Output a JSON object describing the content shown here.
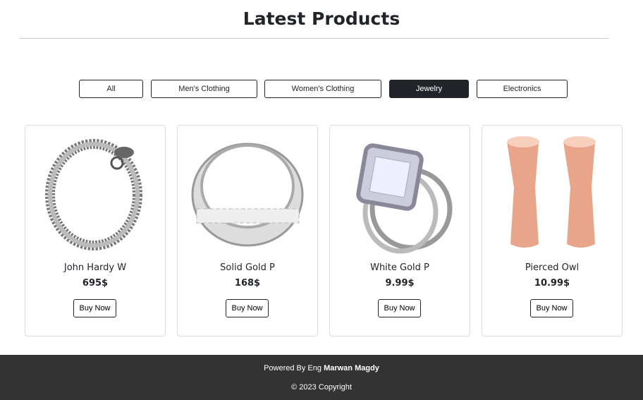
{
  "header": {
    "title": "Latest Products"
  },
  "filters": [
    {
      "label": "All"
    },
    {
      "label": "Men's Clothing"
    },
    {
      "label": "Women's Clothing"
    },
    {
      "label": "Jewelry",
      "active": true
    },
    {
      "label": "Electronics"
    }
  ],
  "products": [
    {
      "name": "John Hardy W",
      "price": "695$",
      "buy": "Buy Now"
    },
    {
      "name": "Solid Gold P",
      "price": "168$",
      "buy": "Buy Now"
    },
    {
      "name": "White Gold P",
      "price": "9.99$",
      "buy": "Buy Now"
    },
    {
      "name": "Pierced Owl",
      "price": "10.99$",
      "buy": "Buy Now"
    }
  ],
  "footer": {
    "powered": "Powered By Eng",
    "author": "Marwan Magdy",
    "copyright": "© 2023 Copyright"
  }
}
